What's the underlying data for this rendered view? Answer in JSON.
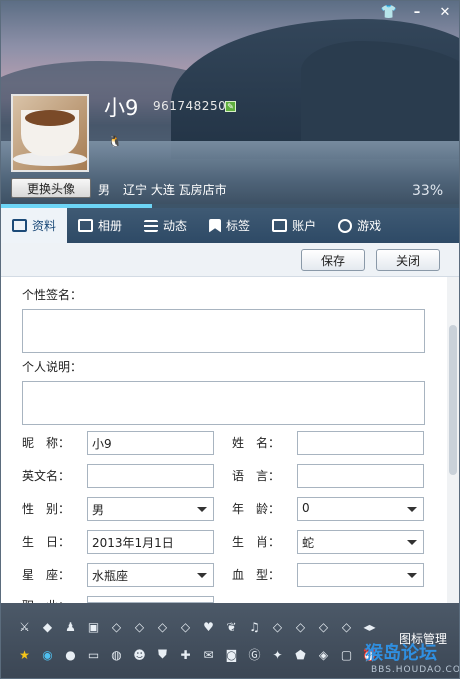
{
  "window": {
    "controls": [
      "skin-icon",
      "minimize-icon",
      "close-icon"
    ]
  },
  "profile": {
    "nickname": "小9",
    "qq_number": "961748250",
    "change_avatar_label": "更换头像",
    "gender": "男",
    "location": "辽宁 大连 瓦房店市",
    "completeness": "33%",
    "completeness_value": 0.33
  },
  "tabs": [
    {
      "label": "资料",
      "icon": "profile-card-icon",
      "active": true
    },
    {
      "label": "相册",
      "icon": "album-icon",
      "active": false
    },
    {
      "label": "动态",
      "icon": "feed-icon",
      "active": false
    },
    {
      "label": "标签",
      "icon": "bookmark-icon",
      "active": false
    },
    {
      "label": "账户",
      "icon": "briefcase-icon",
      "active": false
    },
    {
      "label": "游戏",
      "icon": "game-icon",
      "active": false
    }
  ],
  "toolbar": {
    "save_label": "保存",
    "close_label": "关闭"
  },
  "form": {
    "signature_label": "个性签名：",
    "description_label": "个人说明：",
    "nickname_label": "昵　称：",
    "nickname_value": "小9",
    "name_label": "姓　名：",
    "name_value": "",
    "english_name_label": "英文名：",
    "english_name_value": "",
    "language_label": "语　言：",
    "language_value": "",
    "gender_label": "性　别：",
    "gender_value": "男",
    "age_label": "年　龄：",
    "age_value": "0",
    "birthday_label": "生　日：",
    "birthday_value": "2013年1月1日",
    "zodiac_label": "生　肖：",
    "zodiac_value": "蛇",
    "constellation_label": "星　座：",
    "constellation_value": "水瓶座",
    "blood_label": "血　型：",
    "blood_value": "",
    "occupation_label": "职　业："
  },
  "bottom": {
    "icon_manage_label": "图标管理",
    "watermark": "猴岛论坛",
    "watermark_url": "BBS.HOUDAO.COM"
  }
}
